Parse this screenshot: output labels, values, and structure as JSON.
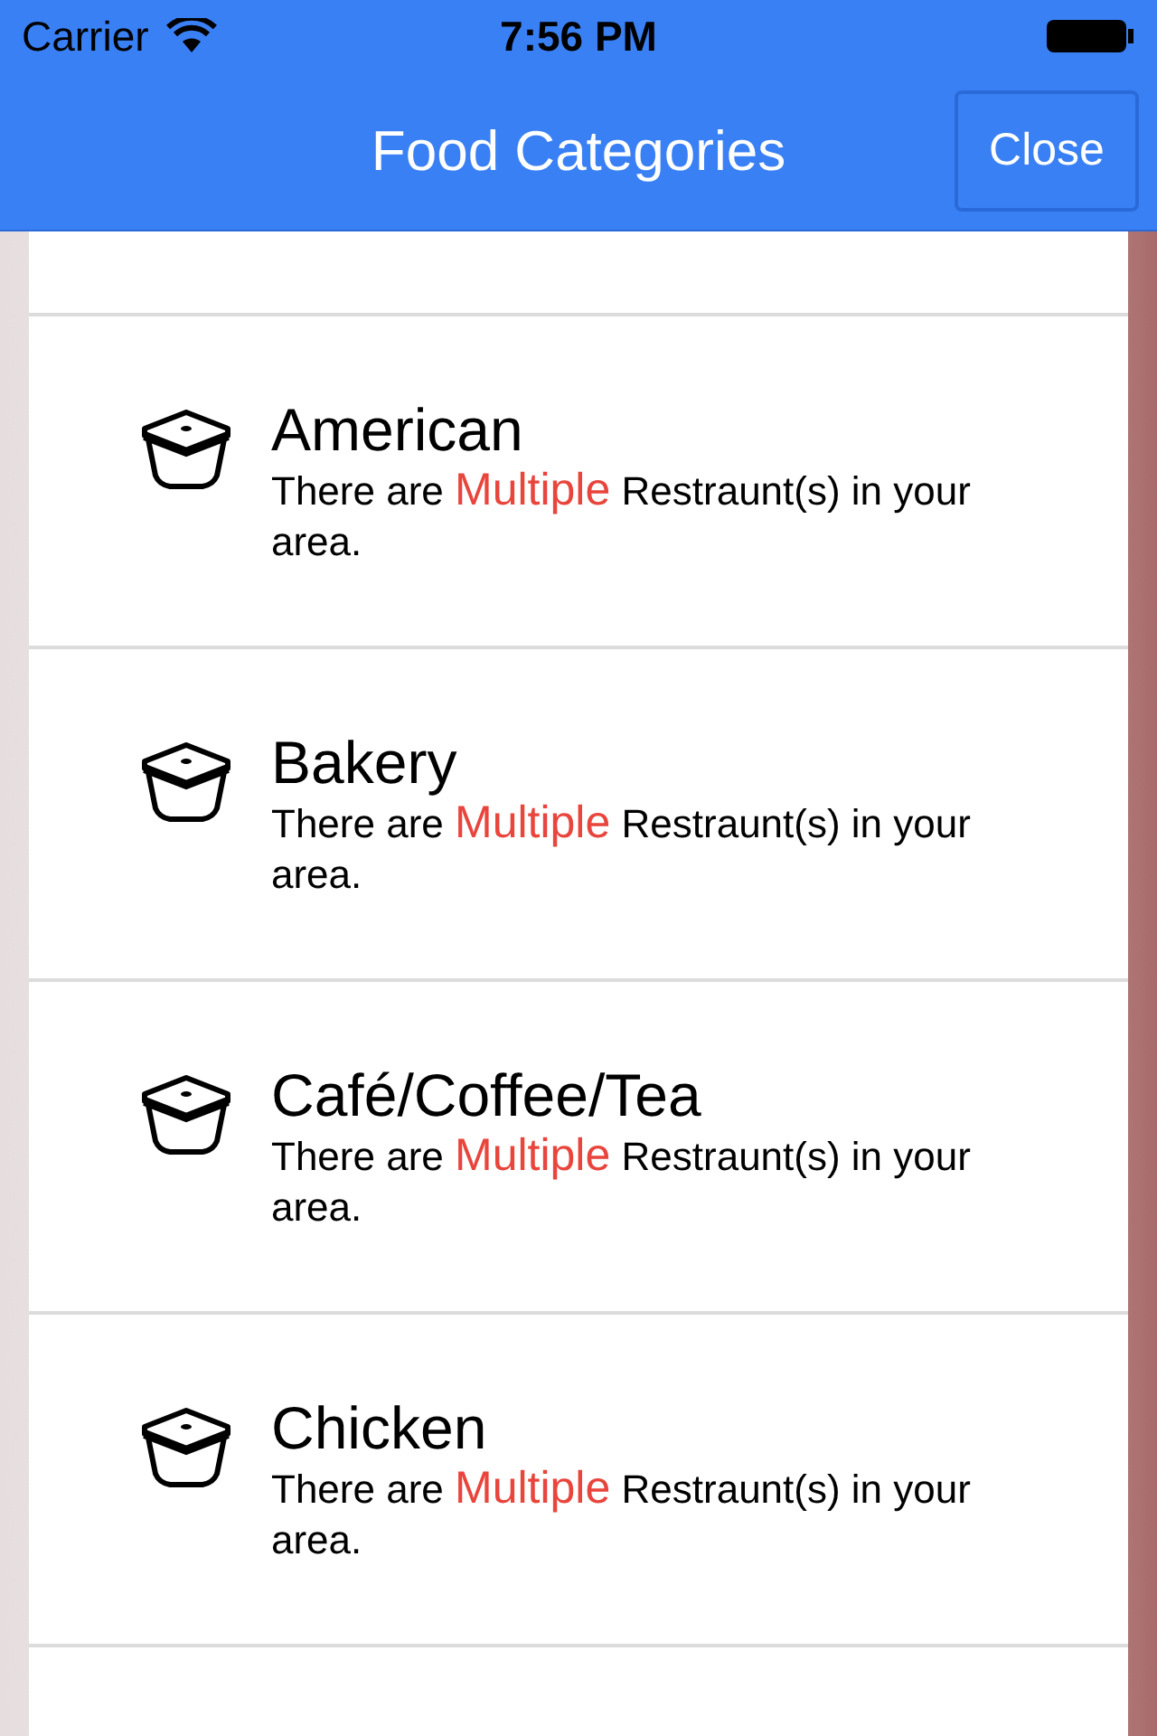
{
  "status_bar": {
    "carrier": "Carrier",
    "time": "7:56 PM"
  },
  "nav_bar": {
    "title": "Food Categories",
    "close_button": "Close"
  },
  "categories": [
    {
      "name": "American",
      "description": {
        "before": "There are ",
        "highlight": "Multiple",
        "after": " Restraunt(s) in your area."
      }
    },
    {
      "name": "Bakery",
      "description": {
        "before": "There are ",
        "highlight": "Multiple",
        "after": " Restraunt(s) in your area."
      }
    },
    {
      "name": "Café/Coffee/Tea",
      "description": {
        "before": "There are ",
        "highlight": "Multiple",
        "after": " Restraunt(s) in your area."
      }
    },
    {
      "name": "Chicken",
      "description": {
        "before": "There are ",
        "highlight": "Multiple",
        "after": " Restraunt(s) in your area."
      }
    }
  ]
}
